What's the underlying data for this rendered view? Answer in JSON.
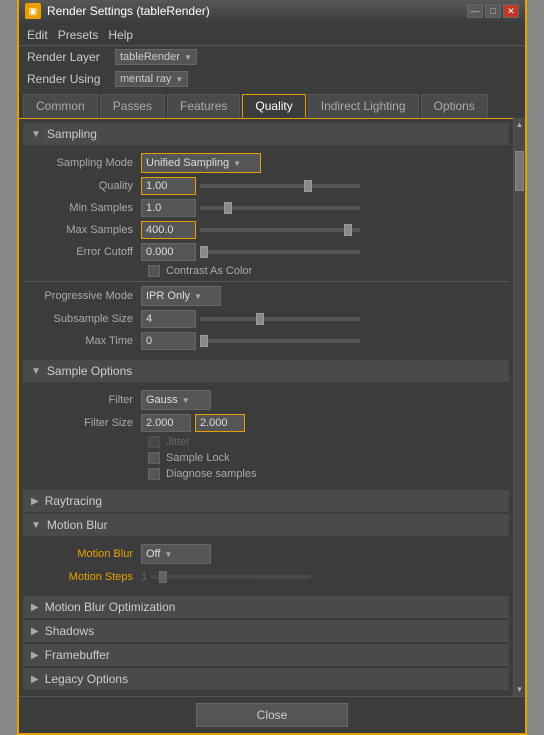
{
  "window": {
    "title": "Render Settings (tableRender)",
    "icon": "render-icon"
  },
  "menu": {
    "items": [
      "Edit",
      "Presets",
      "Help"
    ]
  },
  "render_layer": {
    "label": "Render Layer",
    "value": "tableRender"
  },
  "render_using": {
    "label": "Render Using",
    "value": "mental ray"
  },
  "tabs": [
    {
      "id": "common",
      "label": "Common"
    },
    {
      "id": "passes",
      "label": "Passes"
    },
    {
      "id": "features",
      "label": "Features"
    },
    {
      "id": "quality",
      "label": "Quality",
      "active": true
    },
    {
      "id": "indirect_lighting",
      "label": "Indirect Lighting"
    },
    {
      "id": "options",
      "label": "Options"
    }
  ],
  "sampling": {
    "section_title": "Sampling",
    "sampling_mode_label": "Sampling Mode",
    "sampling_mode_value": "Unified Sampling",
    "quality_label": "Quality",
    "quality_value": "1.00",
    "min_samples_label": "Min Samples",
    "min_samples_value": "1.0",
    "max_samples_label": "Max Samples",
    "max_samples_value": "400.0",
    "error_cutoff_label": "Error Cutoff",
    "error_cutoff_value": "0.000",
    "contrast_as_color_label": "Contrast As Color",
    "progressive_mode_label": "Progressive Mode",
    "progressive_mode_value": "IPR Only",
    "subsample_size_label": "Subsample Size",
    "subsample_size_value": "4",
    "max_time_label": "Max Time",
    "max_time_value": "0"
  },
  "sample_options": {
    "section_title": "Sample Options",
    "filter_label": "Filter",
    "filter_value": "Gauss",
    "filter_size_label": "Filter Size",
    "filter_size_value1": "2.000",
    "filter_size_value2": "2.000",
    "jitter_label": "Jitter",
    "sample_lock_label": "Sample Lock",
    "diagnose_samples_label": "Diagnose samples"
  },
  "raytracing": {
    "section_title": "Raytracing"
  },
  "motion_blur": {
    "section_title": "Motion Blur",
    "motion_blur_label": "Motion Blur",
    "motion_blur_value": "Off",
    "motion_steps_label": "Motion Steps",
    "motion_steps_value": "1"
  },
  "motion_blur_optimization": {
    "section_title": "Motion Blur Optimization"
  },
  "shadows": {
    "section_title": "Shadows"
  },
  "framebuffer": {
    "section_title": "Framebuffer"
  },
  "legacy_options": {
    "section_title": "Legacy Options"
  },
  "close_button_label": "Close"
}
